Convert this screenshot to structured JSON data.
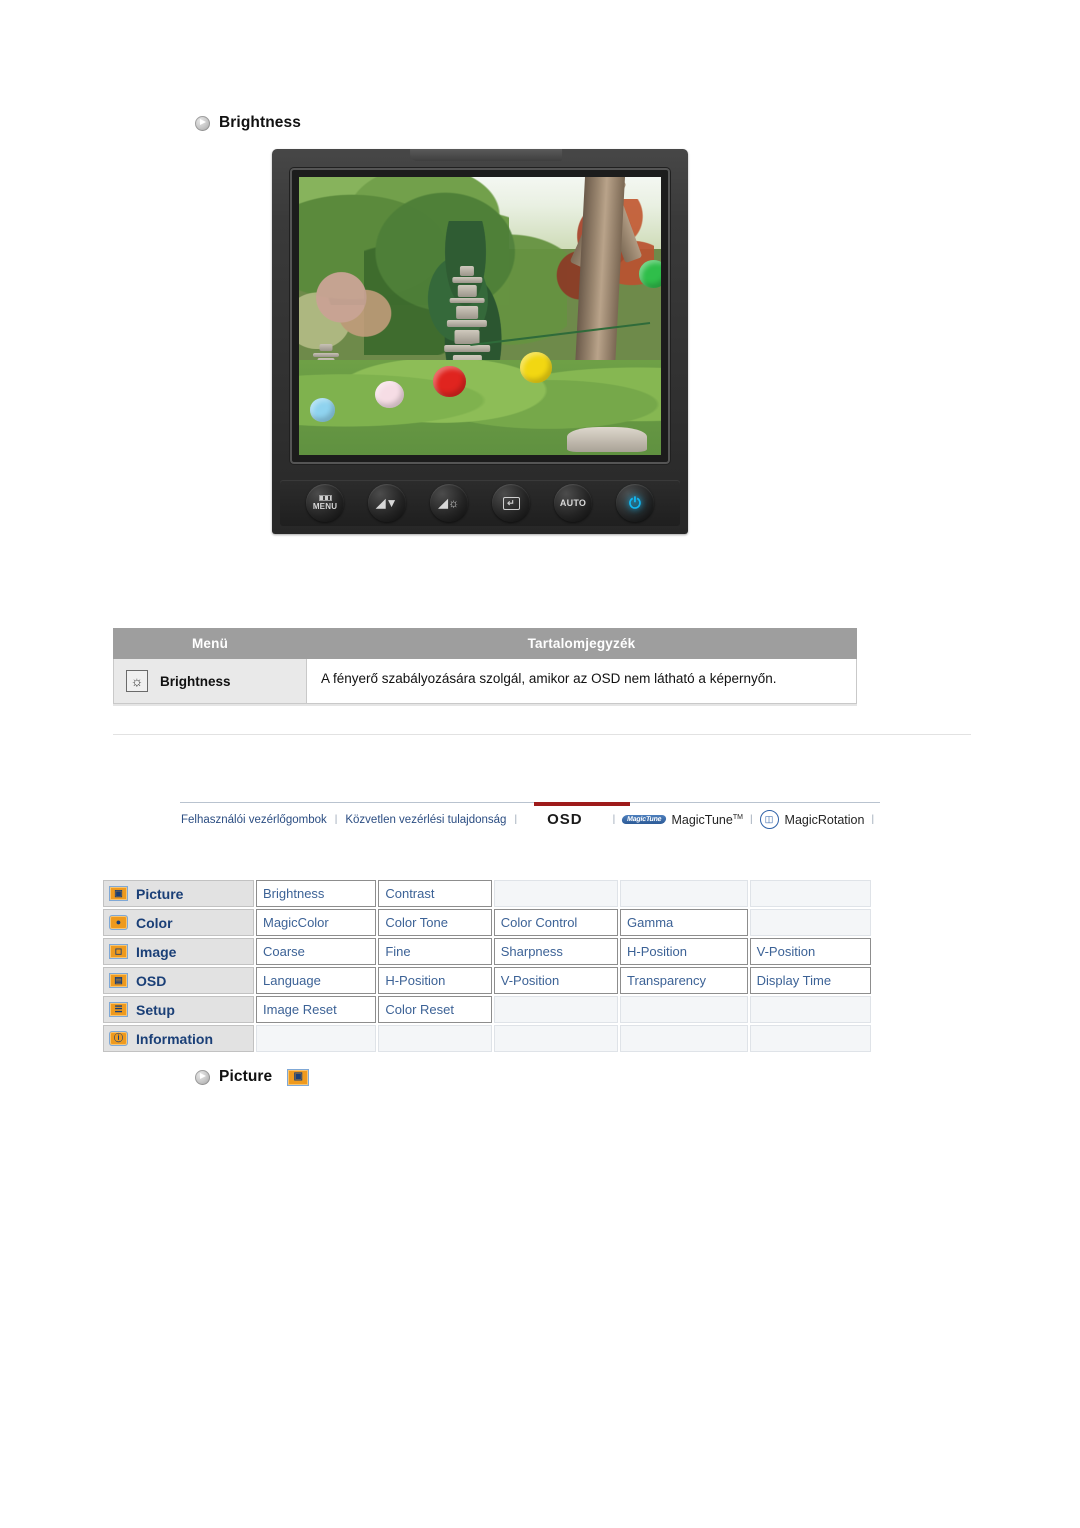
{
  "page": {
    "brightness_heading": "Brightness",
    "picture_heading": "Picture"
  },
  "monitor": {
    "buttons": [
      {
        "name": "menu-button",
        "caption": "MENU",
        "glyph": "bars"
      },
      {
        "name": "down-button",
        "caption": "",
        "glyph": "down"
      },
      {
        "name": "brightness-button",
        "caption": "",
        "glyph": "brightness"
      },
      {
        "name": "enter-button",
        "caption": "",
        "glyph": "enter"
      },
      {
        "name": "auto-button",
        "caption": "AUTO",
        "glyph": "text"
      },
      {
        "name": "power-button",
        "caption": "",
        "glyph": "power"
      }
    ]
  },
  "desc_table": {
    "headers": {
      "menu": "Menü",
      "contents": "Tartalomjegyzék"
    },
    "rows": [
      {
        "icon": "brightness-icon",
        "label": "Brightness",
        "description": "A fényerő szabályozására szolgál, amikor az OSD nem látható a képernyőn."
      }
    ]
  },
  "navbar": {
    "items": [
      {
        "label": "Felhasználói vezérlőgombok",
        "active": false,
        "logo": "none"
      },
      {
        "label": "Közvetlen vezérlési tulajdonság",
        "active": false,
        "logo": "none"
      },
      {
        "label": "OSD",
        "active": true,
        "logo": "none"
      },
      {
        "label": "MagicTune",
        "active": false,
        "logo": "magictune",
        "logo_text": "MagicTune",
        "sup": "TM"
      },
      {
        "label": "MagicRotation",
        "active": false,
        "logo": "magicrotation",
        "logo_text": "MagicRotation",
        "sup": ""
      }
    ],
    "separator": "|"
  },
  "menu_grid": {
    "rows": [
      {
        "icon": "picture-icon",
        "category": "Picture",
        "items": [
          "Brightness",
          "Contrast",
          "",
          "",
          ""
        ]
      },
      {
        "icon": "color-icon",
        "category": "Color",
        "items": [
          "MagicColor",
          "Color Tone",
          "Color Control",
          "Gamma",
          ""
        ]
      },
      {
        "icon": "image-icon",
        "category": "Image",
        "items": [
          "Coarse",
          "Fine",
          "Sharpness",
          "H-Position",
          "V-Position"
        ]
      },
      {
        "icon": "osd-icon",
        "category": "OSD",
        "items": [
          "Language",
          "H-Position",
          "V-Position",
          "Transparency",
          "Display Time"
        ]
      },
      {
        "icon": "setup-icon",
        "category": "Setup",
        "items": [
          "Image Reset",
          "Color Reset",
          "",
          "",
          ""
        ]
      },
      {
        "icon": "information-icon",
        "category": "Information",
        "items": [
          "",
          "",
          "",
          "",
          ""
        ]
      }
    ]
  },
  "colors": {
    "accent_red": "#9e1b1b",
    "link_blue": "#3c6296",
    "category_blue": "#1a3f77",
    "header_gray": "#9e9e9e",
    "icon_orange": "#ee9a1e"
  }
}
